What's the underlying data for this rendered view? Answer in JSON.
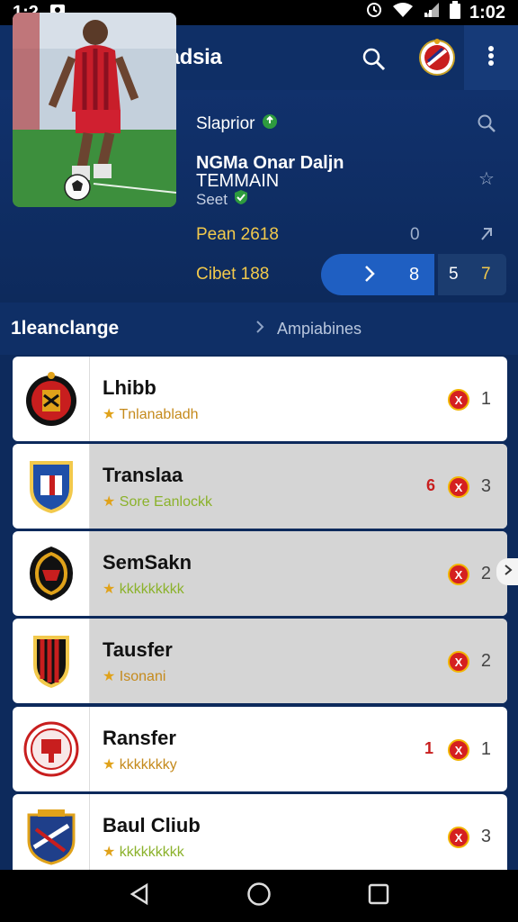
{
  "status_bar": {
    "time_left": "1:2",
    "time_right": "1:02"
  },
  "app_bar": {
    "title": "Sepak Indadsia"
  },
  "hero": {
    "line1": "Slaprior",
    "line2a": "NGMa Onar Daljn",
    "line2b": "TEMMAIN",
    "line3": "Seet",
    "row_pean_label": "Pean 2618",
    "row_pean_val": "0",
    "row_cibet_label": "Cibet 188",
    "stat_pill_val": "8",
    "stat_box_a": "5",
    "stat_box_b": "7"
  },
  "section": {
    "label": "1leanclange",
    "link": "Ampiabines"
  },
  "items": [
    {
      "name": "Lhibb",
      "sub": "Tnlanabladh",
      "badge": "X",
      "num": "1"
    },
    {
      "name": "Translaa",
      "sub": "Sore Eanlockk",
      "badge": "X",
      "num": "3",
      "pre": "6"
    },
    {
      "name": "SemSakn",
      "sub": "kkkkkkkkk",
      "badge": "X",
      "num": "2"
    },
    {
      "name": "Tausfer",
      "sub": "Isonani",
      "badge": "X",
      "num": "2"
    },
    {
      "name": "Ransfer",
      "sub": "kkkkkkky",
      "badge": "X",
      "num": "1",
      "pre": "1"
    },
    {
      "name": "Baul Cliub",
      "sub": "kkkkkkkkk",
      "badge": "X",
      "num": "3"
    }
  ],
  "colors": {
    "primary": "#0f2f66",
    "accent": "#1f5fc2",
    "gold": "#f2c94c"
  }
}
